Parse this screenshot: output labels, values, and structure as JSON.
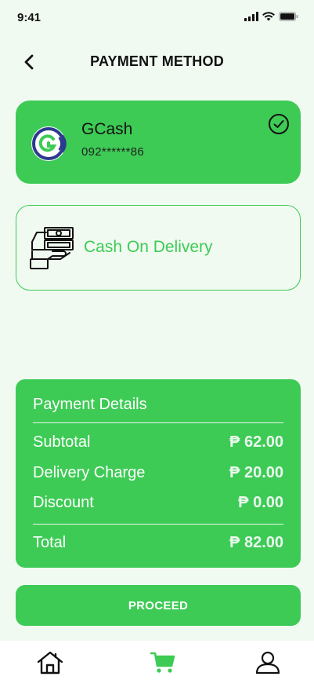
{
  "status_bar": {
    "time": "9:41"
  },
  "header": {
    "title": "PAYMENT METHOD"
  },
  "payment_methods": {
    "gcash": {
      "name": "GCash",
      "number": "092******86",
      "selected": true
    },
    "cod": {
      "label": "Cash On Delivery",
      "selected": false
    }
  },
  "payment_details": {
    "title": "Payment Details",
    "rows": [
      {
        "label": "Subtotal",
        "amount": "₱ 62.00"
      },
      {
        "label": "Delivery Charge",
        "amount": "₱ 20.00"
      },
      {
        "label": "Discount",
        "amount": "₱ 0.00"
      }
    ],
    "total": {
      "label": "Total",
      "amount": "₱ 82.00"
    }
  },
  "actions": {
    "proceed_label": "PROCEED"
  },
  "nav": {
    "active": "cart"
  },
  "colors": {
    "accent": "#3dcb55",
    "background": "#f1faf1",
    "dark": "#111111",
    "gcash_blue": "#2b3a8f"
  }
}
